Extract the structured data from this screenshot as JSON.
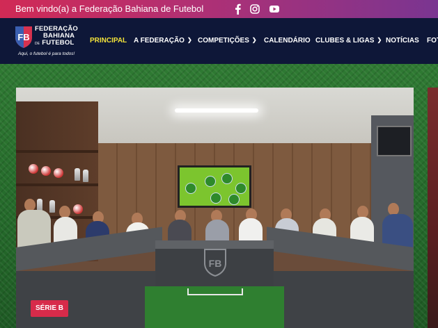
{
  "topbar": {
    "welcome_text": "Bem vindo(a) a Federação Bahiana de Futebol",
    "social": [
      "facebook-icon",
      "instagram-icon",
      "youtube-icon"
    ],
    "gradient_colors": [
      "#d12a55",
      "#7a3591"
    ]
  },
  "header": {
    "logo": {
      "line1": "FEDERAÇÃO",
      "line2": "BAHIANA",
      "line3_small": "DE",
      "line3": "FUTEBOL",
      "slogan": "Aqui, o futebol é para todos!"
    },
    "nav": [
      {
        "label": "PRINCIPAL",
        "active": true,
        "dropdown": false
      },
      {
        "label": "A FEDERAÇÃO",
        "active": false,
        "dropdown": true
      },
      {
        "label": "COMPETIÇÕES",
        "active": false,
        "dropdown": true
      },
      {
        "label": "CALENDÁRIO",
        "active": false,
        "dropdown": false
      },
      {
        "label": "CLUBES & LIGAS",
        "active": false,
        "dropdown": true
      },
      {
        "label": "NOTÍCIAS",
        "active": false,
        "dropdown": false
      },
      {
        "label": "FOT",
        "active": false,
        "dropdown": false
      }
    ],
    "background_color": "#0e1738",
    "active_color": "#f2e23a"
  },
  "hero": {
    "badge_label": "SÉRIE B",
    "badge_color": "#d72b4a"
  }
}
